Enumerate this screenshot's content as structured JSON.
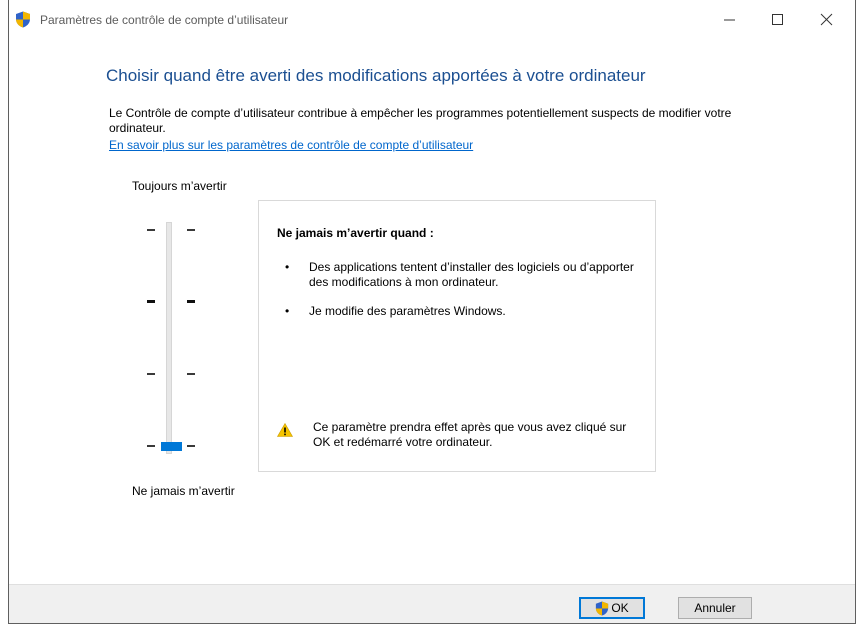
{
  "window": {
    "title": "Paramètres de contrôle de compte d’utilisateur",
    "controls": {
      "minimize": "—",
      "maximize": "☐",
      "close": "✕"
    }
  },
  "main": {
    "heading": "Choisir quand être averti des modifications apportées à votre ordinateur",
    "description": "Le Contrôle de compte d’utilisateur contribue à empêcher les programmes potentiellement suspects de modifier votre ordinateur.",
    "learn_more_link": "En savoir plus sur les paramètres de contrôle de compte d’utilisateur"
  },
  "slider": {
    "top_label": "Toujours m’avertir",
    "bottom_label": "Ne jamais m’avertir",
    "levels": 4,
    "selected_level": 1,
    "accent_color": "#0078d7"
  },
  "info": {
    "title": "Ne jamais m’avertir quand :",
    "bullets": [
      "Des applications tentent d’installer des logiciels ou d’apporter des modifications à mon ordinateur.",
      "Je modifie des paramètres Windows."
    ],
    "bullet_char": "•",
    "warning_icon": "warning-triangle-icon",
    "warning": "Ce paramètre prendra effet après que vous avez cliqué sur OK et redémarré votre ordinateur."
  },
  "footer": {
    "ok_label": "OK",
    "ok_icon": "uac-shield-icon",
    "cancel_label": "Annuler"
  }
}
